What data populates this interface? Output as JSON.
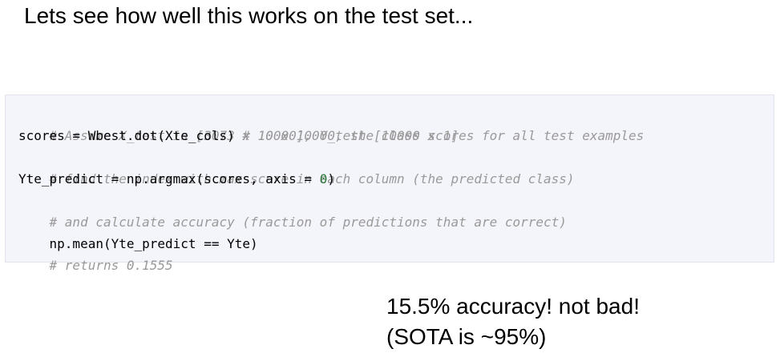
{
  "title": "Lets see how well this works on the test set...",
  "code": {
    "line1_comment": "# Assume X_test is [3073 x 10000], Y_test [10000 x 1]",
    "line2_code": "scores = Wbest.dot(Xte_cols) ",
    "line2_comment": "# 10 x 10000, the class scores for all test examples",
    "line3_comment": "# find the index with max score in each column (the predicted class)",
    "line4_code_a": "Yte_predict = np.argmax(scores, axis = ",
    "line4_num": "0",
    "line4_code_b": ")",
    "line5_comment": "# and calculate accuracy (fraction of predictions that are correct)",
    "line6_code": "np.mean(Yte_predict == Yte)",
    "line7_comment": "# returns 0.1555"
  },
  "conclusion": {
    "line1": "15.5% accuracy! not bad!",
    "line2": "(SOTA is ~95%)"
  }
}
